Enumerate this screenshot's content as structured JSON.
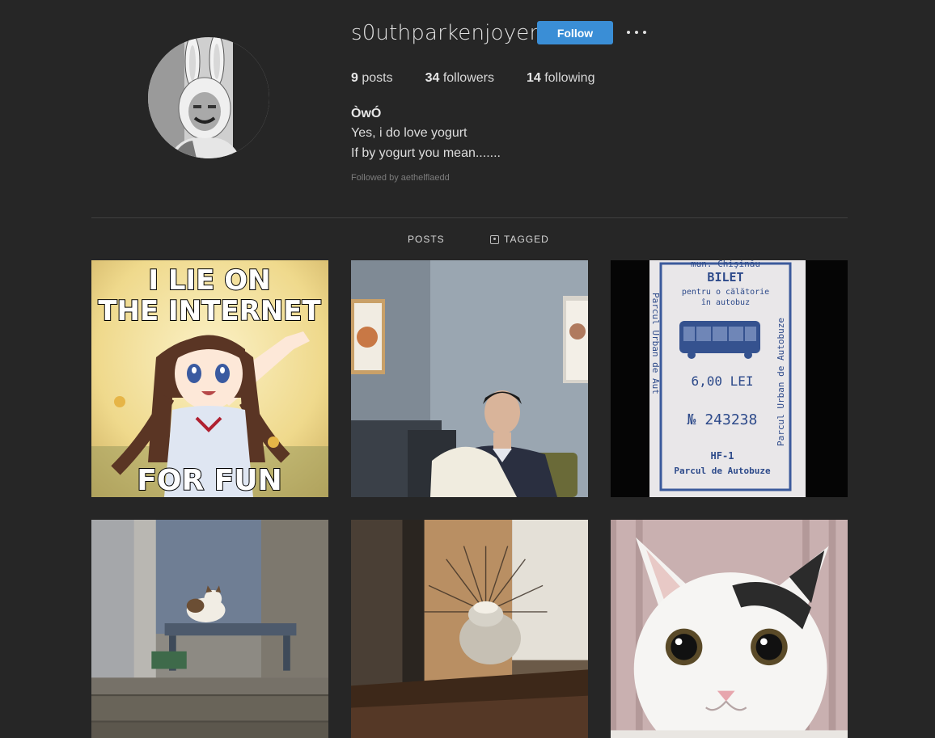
{
  "profile": {
    "username": "s0uthparkenjoyer",
    "follow_label": "Follow",
    "more_icon": "more-horizontal-icon",
    "stats": {
      "posts_count": "9",
      "posts_label": " posts",
      "followers_count": "34",
      "followers_label": " followers",
      "following_count": "14",
      "following_label": " following"
    },
    "bio": {
      "name": "ÒwÓ",
      "line1": "Yes, i do love yogurt",
      "line2": "If by yogurt you mean......."
    },
    "followed_by": "Followed by aethelflaedd"
  },
  "tabs": [
    {
      "label": "POSTS",
      "icon": null,
      "active": true
    },
    {
      "label": "TAGGED",
      "icon": "tag-user-icon",
      "active": false
    }
  ],
  "posts": {
    "meme_top_1": "I LIE ON",
    "meme_top_2": "THE INTERNET",
    "meme_bottom": "FOR FUN",
    "ticket": {
      "city": "mun. Chişinău",
      "title": "BILET",
      "sub1": "pentru o călătorie",
      "sub2": "în autobuz",
      "price": "6,00 LEI",
      "number": "№ 243238",
      "series": "HF-1",
      "footer": "Parcul de Autobuze",
      "side_left": "Parcul Urban de Aut",
      "side_right": "Parcul Urban de Autobuze"
    }
  },
  "colors": {
    "background": "#262626",
    "follow_button": "#3a8ed6",
    "divider": "#3f3f3f",
    "ticket_ink": "#2d4a8a"
  }
}
